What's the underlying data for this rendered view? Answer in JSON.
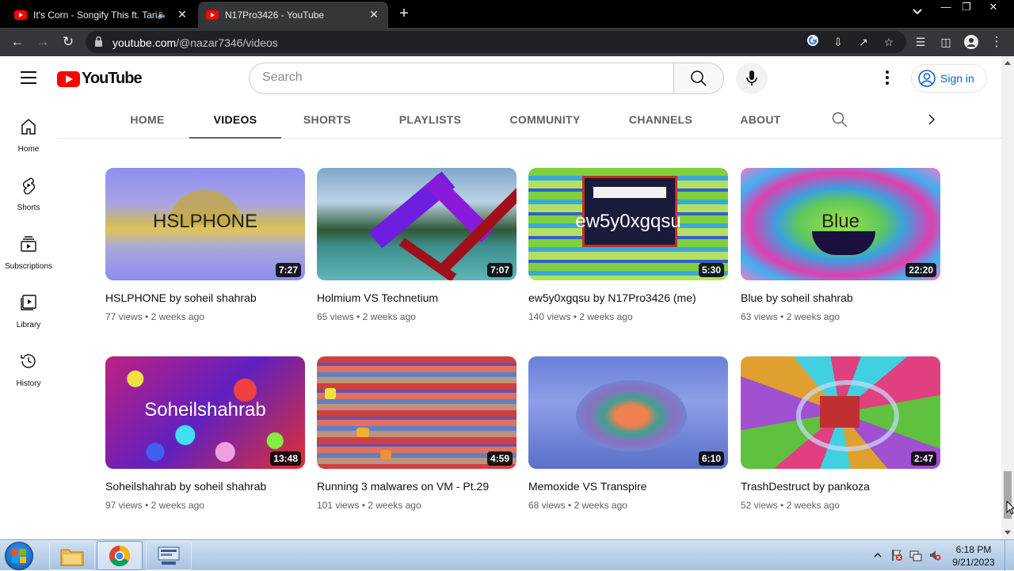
{
  "browser": {
    "tabs": [
      {
        "title": "It's Corn - Songify This ft. Tariq",
        "audio": true
      },
      {
        "title": "N17Pro3426 - YouTube",
        "active": true
      }
    ],
    "new_tab_symbol": "+",
    "url": {
      "host": "youtube.com",
      "path": "/@nazar7346/videos"
    }
  },
  "masthead": {
    "logo_text": "YouTube",
    "search_placeholder": "Search",
    "signin_label": "Sign in"
  },
  "rail": [
    {
      "label": "Home",
      "icon": "home-icon"
    },
    {
      "label": "Shorts",
      "icon": "shorts-icon"
    },
    {
      "label": "Subscriptions",
      "icon": "subscriptions-icon"
    },
    {
      "label": "Library",
      "icon": "library-icon"
    },
    {
      "label": "History",
      "icon": "history-icon"
    }
  ],
  "channel_tabs": [
    "HOME",
    "VIDEOS",
    "SHORTS",
    "PLAYLISTS",
    "COMMUNITY",
    "CHANNELS",
    "ABOUT"
  ],
  "active_channel_tab": "VIDEOS",
  "videos": [
    {
      "title": "HSLPHONE by soheil shahrab",
      "views": "77 views",
      "age": "2 weeks ago",
      "duration": "7:27",
      "thumb_text": "HSLPHONE"
    },
    {
      "title": "Holmium VS Technetium",
      "views": "65 views",
      "age": "2 weeks ago",
      "duration": "7:07",
      "thumb_text": ""
    },
    {
      "title": "ew5y0xgqsu by N17Pro3426 (me)",
      "views": "140 views",
      "age": "2 weeks ago",
      "duration": "5:30",
      "thumb_text": "ew5y0xgqsu"
    },
    {
      "title": "Blue by soheil shahrab",
      "views": "63 views",
      "age": "2 weeks ago",
      "duration": "22:20",
      "thumb_text": "Blue"
    },
    {
      "title": "Soheilshahrab by soheil shahrab",
      "views": "97 views",
      "age": "2 weeks ago",
      "duration": "13:48",
      "thumb_text": "Soheilshahrab"
    },
    {
      "title": "Running 3 malwares on VM - Pt.29",
      "views": "101 views",
      "age": "2 weeks ago",
      "duration": "4:59",
      "thumb_text": ""
    },
    {
      "title": "Memoxide VS Transpire",
      "views": "68 views",
      "age": "2 weeks ago",
      "duration": "6:10",
      "thumb_text": ""
    },
    {
      "title": "TrashDestruct by pankoza",
      "views": "52 views",
      "age": "2 weeks ago",
      "duration": "2:47",
      "thumb_text": ""
    }
  ],
  "taskbar": {
    "time": "6:18 PM",
    "date": "9/21/2023"
  },
  "colors": {
    "youtube_red": "#ff0000",
    "link_blue": "#065fd4",
    "chrome_dark": "#35363a"
  }
}
